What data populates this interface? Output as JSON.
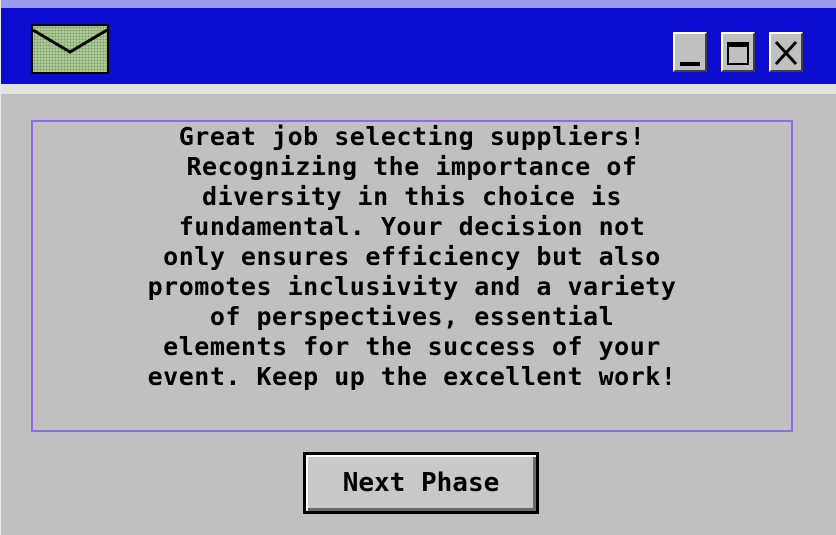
{
  "window": {
    "icon": "envelope-icon",
    "titlebar_color": "#0c0cd0",
    "controls": {
      "minimize_icon": "minimize-icon",
      "maximize_icon": "maximize-icon",
      "close_icon": "close-icon"
    }
  },
  "dialog": {
    "message": "Great job selecting suppliers!\nRecognizing the importance of\ndiversity in this choice is\nfundamental. Your decision not\nonly ensures efficiency but also\npromotes inclusivity and a variety\nof perspectives, essential\nelements for the success of your\nevent. Keep up the excellent work!",
    "border_color": "#9068e8",
    "next_button_label": "Next Phase"
  }
}
